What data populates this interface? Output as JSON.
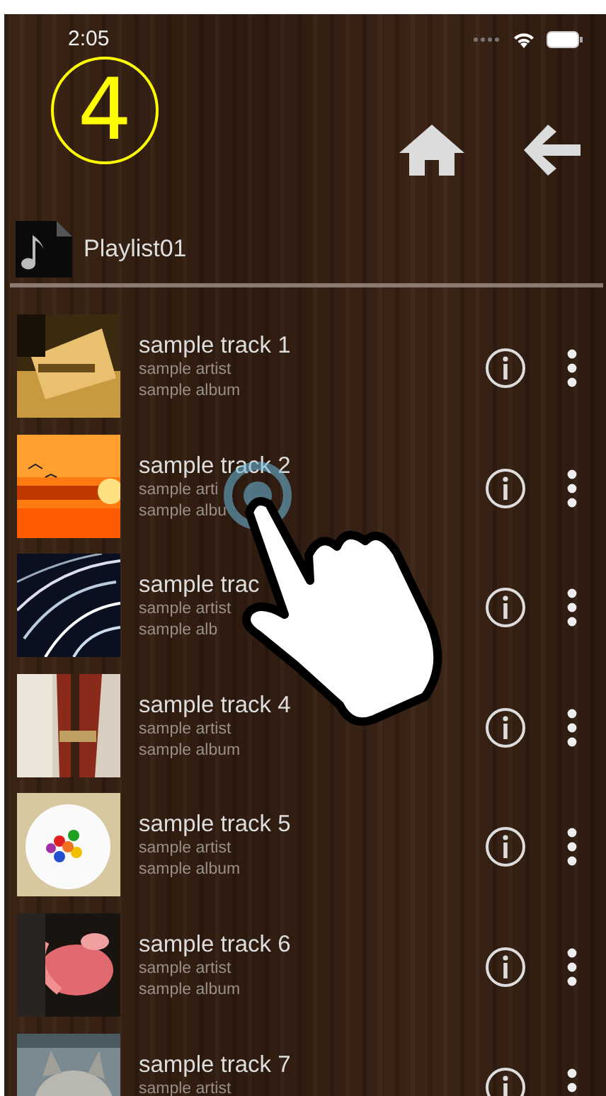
{
  "annotation": {
    "number": "4"
  },
  "status_bar": {
    "time": "2:05"
  },
  "playlist": {
    "title": "Playlist01"
  },
  "tracks": [
    {
      "title": "sample track 1",
      "artist": "sample artist",
      "album": "sample album"
    },
    {
      "title": "sample track 2",
      "artist": "sample arti",
      "album": "sample albu"
    },
    {
      "title": "sample trac",
      "artist": "sample artist",
      "album": "sample alb"
    },
    {
      "title": "sample track 4",
      "artist": "sample artist",
      "album": "sample album"
    },
    {
      "title": "sample track 5",
      "artist": "sample artist",
      "album": "sample album"
    },
    {
      "title": "sample track 6",
      "artist": "sample artist",
      "album": "sample album"
    },
    {
      "title": "sample track 7",
      "artist": "sample artist"
    }
  ]
}
